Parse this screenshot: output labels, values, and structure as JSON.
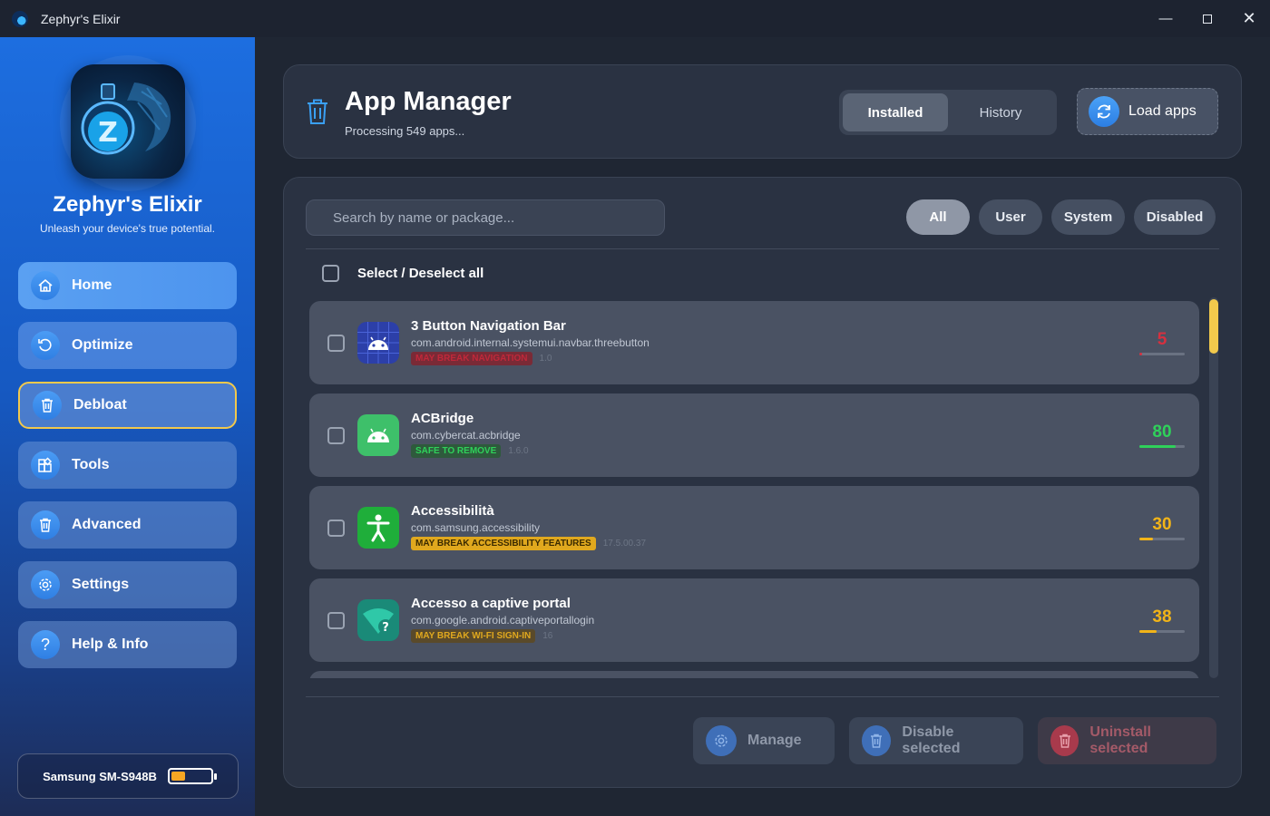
{
  "window": {
    "title": "Zephyr's Elixir",
    "minimize_icon": "minimize-icon",
    "maximize_icon": "maximize-icon",
    "close_icon": "close-icon"
  },
  "sidebar": {
    "brand": "Zephyr's Elixir",
    "tagline": "Unleash your device's true potential.",
    "items": [
      {
        "label": "Home",
        "icon": "home-icon"
      },
      {
        "label": "Optimize",
        "icon": "refresh-icon"
      },
      {
        "label": "Debloat",
        "icon": "trash-icon",
        "active": true
      },
      {
        "label": "Tools",
        "icon": "tools-icon"
      },
      {
        "label": "Advanced",
        "icon": "trash-icon"
      },
      {
        "label": "Settings",
        "icon": "gear-icon"
      },
      {
        "label": "Help & Info",
        "icon": "help-icon"
      }
    ],
    "device": {
      "name": "Samsung SM-S948B",
      "battery_level": 0.35
    }
  },
  "header": {
    "title": "App Manager",
    "subtitle": "Processing 549 apps...",
    "tabs": [
      {
        "label": "Installed",
        "selected": true
      },
      {
        "label": "History",
        "selected": false
      }
    ],
    "load_button": "Load apps"
  },
  "main": {
    "search_placeholder": "Search by name or package...",
    "filters": [
      {
        "label": "All",
        "selected": true
      },
      {
        "label": "User"
      },
      {
        "label": "System"
      },
      {
        "label": "Disabled"
      }
    ],
    "select_all_label": "Select / Deselect all",
    "apps": [
      {
        "name": "3 Button Navigation Bar",
        "package": "com.android.internal.systemui.navbar.threebutton",
        "badge": "MAY BREAK NAVIGATION",
        "badge_color": "#c0283a",
        "badge_text_color": "#c0283a",
        "badge_bg": "#7a2a36",
        "version": "1.0",
        "score": "5",
        "score_value": 5,
        "score_color": "#d6303f",
        "icon": "android-icon"
      },
      {
        "name": "ACBridge",
        "package": "com.cybercat.acbridge",
        "badge": "SAFE TO REMOVE",
        "badge_text_color": "#2fd15a",
        "badge_bg": "#2e5a3c",
        "version": "1.6.0",
        "score": "80",
        "score_value": 80,
        "score_color": "#2fd15a",
        "icon": "android-icon"
      },
      {
        "name": "Accessibilità",
        "package": "com.samsung.accessibility",
        "badge": "MAY BREAK ACCESSIBILITY FEATURES",
        "badge_text_color": "#3a2a00",
        "badge_bg": "#e0a81e",
        "version": "17.5.00.37",
        "score": "30",
        "score_value": 30,
        "score_color": "#f2b418",
        "icon": "accessibility-icon"
      },
      {
        "name": "Accesso a captive portal",
        "package": "com.google.android.captiveportallogin",
        "badge": "MAY BREAK WI-FI SIGN-IN",
        "badge_text_color": "#e0a81e",
        "badge_bg": "#5a4a2a",
        "version": "16",
        "score": "38",
        "score_value": 38,
        "score_color": "#f2b418",
        "icon": "wifi-icon"
      }
    ]
  },
  "actions": [
    {
      "label": "Manage",
      "icon": "gear-icon"
    },
    {
      "label": "Disable selected",
      "icon": "trash-icon"
    },
    {
      "label": "Uninstall selected",
      "icon": "trash-icon"
    }
  ]
}
